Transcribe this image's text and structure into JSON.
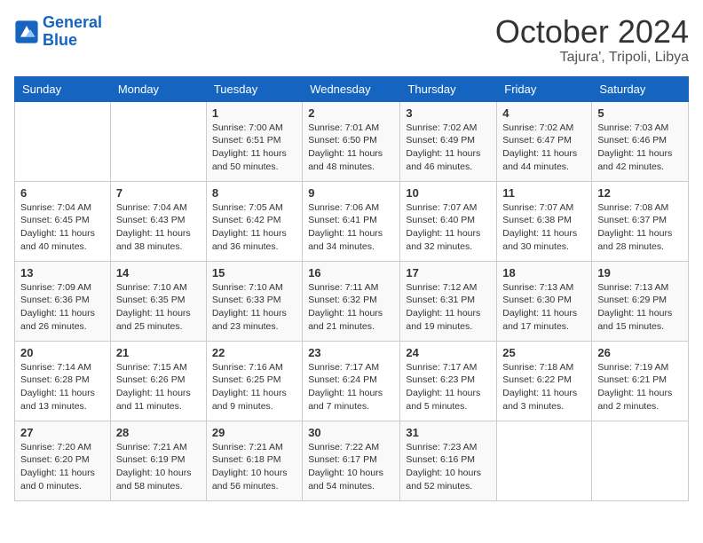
{
  "header": {
    "logo_line1": "General",
    "logo_line2": "Blue",
    "month": "October 2024",
    "location": "Tajura', Tripoli, Libya"
  },
  "weekdays": [
    "Sunday",
    "Monday",
    "Tuesday",
    "Wednesday",
    "Thursday",
    "Friday",
    "Saturday"
  ],
  "weeks": [
    [
      {
        "day": "",
        "info": ""
      },
      {
        "day": "",
        "info": ""
      },
      {
        "day": "1",
        "info": "Sunrise: 7:00 AM\nSunset: 6:51 PM\nDaylight: 11 hours and 50 minutes."
      },
      {
        "day": "2",
        "info": "Sunrise: 7:01 AM\nSunset: 6:50 PM\nDaylight: 11 hours and 48 minutes."
      },
      {
        "day": "3",
        "info": "Sunrise: 7:02 AM\nSunset: 6:49 PM\nDaylight: 11 hours and 46 minutes."
      },
      {
        "day": "4",
        "info": "Sunrise: 7:02 AM\nSunset: 6:47 PM\nDaylight: 11 hours and 44 minutes."
      },
      {
        "day": "5",
        "info": "Sunrise: 7:03 AM\nSunset: 6:46 PM\nDaylight: 11 hours and 42 minutes."
      }
    ],
    [
      {
        "day": "6",
        "info": "Sunrise: 7:04 AM\nSunset: 6:45 PM\nDaylight: 11 hours and 40 minutes."
      },
      {
        "day": "7",
        "info": "Sunrise: 7:04 AM\nSunset: 6:43 PM\nDaylight: 11 hours and 38 minutes."
      },
      {
        "day": "8",
        "info": "Sunrise: 7:05 AM\nSunset: 6:42 PM\nDaylight: 11 hours and 36 minutes."
      },
      {
        "day": "9",
        "info": "Sunrise: 7:06 AM\nSunset: 6:41 PM\nDaylight: 11 hours and 34 minutes."
      },
      {
        "day": "10",
        "info": "Sunrise: 7:07 AM\nSunset: 6:40 PM\nDaylight: 11 hours and 32 minutes."
      },
      {
        "day": "11",
        "info": "Sunrise: 7:07 AM\nSunset: 6:38 PM\nDaylight: 11 hours and 30 minutes."
      },
      {
        "day": "12",
        "info": "Sunrise: 7:08 AM\nSunset: 6:37 PM\nDaylight: 11 hours and 28 minutes."
      }
    ],
    [
      {
        "day": "13",
        "info": "Sunrise: 7:09 AM\nSunset: 6:36 PM\nDaylight: 11 hours and 26 minutes."
      },
      {
        "day": "14",
        "info": "Sunrise: 7:10 AM\nSunset: 6:35 PM\nDaylight: 11 hours and 25 minutes."
      },
      {
        "day": "15",
        "info": "Sunrise: 7:10 AM\nSunset: 6:33 PM\nDaylight: 11 hours and 23 minutes."
      },
      {
        "day": "16",
        "info": "Sunrise: 7:11 AM\nSunset: 6:32 PM\nDaylight: 11 hours and 21 minutes."
      },
      {
        "day": "17",
        "info": "Sunrise: 7:12 AM\nSunset: 6:31 PM\nDaylight: 11 hours and 19 minutes."
      },
      {
        "day": "18",
        "info": "Sunrise: 7:13 AM\nSunset: 6:30 PM\nDaylight: 11 hours and 17 minutes."
      },
      {
        "day": "19",
        "info": "Sunrise: 7:13 AM\nSunset: 6:29 PM\nDaylight: 11 hours and 15 minutes."
      }
    ],
    [
      {
        "day": "20",
        "info": "Sunrise: 7:14 AM\nSunset: 6:28 PM\nDaylight: 11 hours and 13 minutes."
      },
      {
        "day": "21",
        "info": "Sunrise: 7:15 AM\nSunset: 6:26 PM\nDaylight: 11 hours and 11 minutes."
      },
      {
        "day": "22",
        "info": "Sunrise: 7:16 AM\nSunset: 6:25 PM\nDaylight: 11 hours and 9 minutes."
      },
      {
        "day": "23",
        "info": "Sunrise: 7:17 AM\nSunset: 6:24 PM\nDaylight: 11 hours and 7 minutes."
      },
      {
        "day": "24",
        "info": "Sunrise: 7:17 AM\nSunset: 6:23 PM\nDaylight: 11 hours and 5 minutes."
      },
      {
        "day": "25",
        "info": "Sunrise: 7:18 AM\nSunset: 6:22 PM\nDaylight: 11 hours and 3 minutes."
      },
      {
        "day": "26",
        "info": "Sunrise: 7:19 AM\nSunset: 6:21 PM\nDaylight: 11 hours and 2 minutes."
      }
    ],
    [
      {
        "day": "27",
        "info": "Sunrise: 7:20 AM\nSunset: 6:20 PM\nDaylight: 11 hours and 0 minutes."
      },
      {
        "day": "28",
        "info": "Sunrise: 7:21 AM\nSunset: 6:19 PM\nDaylight: 10 hours and 58 minutes."
      },
      {
        "day": "29",
        "info": "Sunrise: 7:21 AM\nSunset: 6:18 PM\nDaylight: 10 hours and 56 minutes."
      },
      {
        "day": "30",
        "info": "Sunrise: 7:22 AM\nSunset: 6:17 PM\nDaylight: 10 hours and 54 minutes."
      },
      {
        "day": "31",
        "info": "Sunrise: 7:23 AM\nSunset: 6:16 PM\nDaylight: 10 hours and 52 minutes."
      },
      {
        "day": "",
        "info": ""
      },
      {
        "day": "",
        "info": ""
      }
    ]
  ]
}
